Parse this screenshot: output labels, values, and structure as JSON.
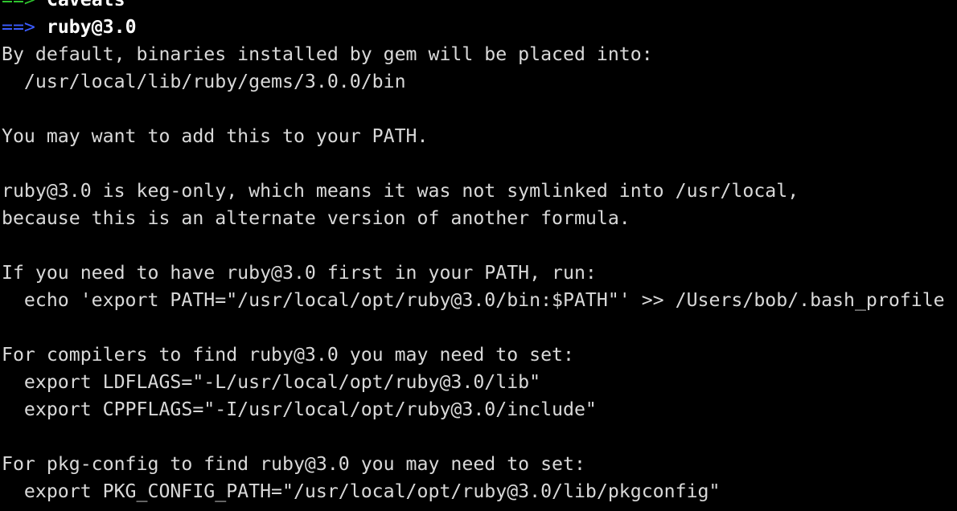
{
  "terminal": {
    "caveats_arrow": "==>",
    "caveats_title": "Caveats",
    "formula_arrow": "==>",
    "formula_title": "ruby@3.0",
    "lines": [
      "By default, binaries installed by gem will be placed into:",
      "  /usr/local/lib/ruby/gems/3.0.0/bin",
      "",
      "You may want to add this to your PATH.",
      "",
      "ruby@3.0 is keg-only, which means it was not symlinked into /usr/local,",
      "because this is an alternate version of another formula.",
      "",
      "If you need to have ruby@3.0 first in your PATH, run:",
      "  echo 'export PATH=\"/usr/local/opt/ruby@3.0/bin:$PATH\"' >> /Users/bob/.bash_profile",
      "",
      "For compilers to find ruby@3.0 you may need to set:",
      "  export LDFLAGS=\"-L/usr/local/opt/ruby@3.0/lib\"",
      "  export CPPFLAGS=\"-I/usr/local/opt/ruby@3.0/include\"",
      "",
      "For pkg-config to find ruby@3.0 you may need to set:",
      "  export PKG_CONFIG_PATH=\"/usr/local/opt/ruby@3.0/lib/pkgconfig\""
    ]
  },
  "colors": {
    "background": "#000000",
    "text": "#d9d9d9",
    "header_text": "#ffffff",
    "arrow_green": "#2ec42e",
    "arrow_blue": "#3b5cff"
  }
}
